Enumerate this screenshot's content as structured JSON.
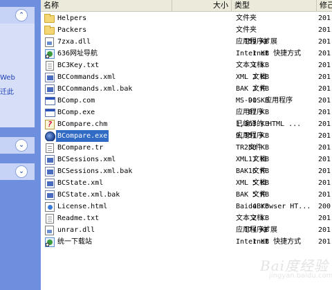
{
  "left_panel": {
    "links": [
      "Web",
      "迁此"
    ]
  },
  "header": {
    "name": "名称",
    "size": "大小",
    "type": "类型",
    "date": "修己"
  },
  "files": [
    {
      "name": "Helpers",
      "size": "",
      "type": "文件夹",
      "date": "201",
      "icon": "folder-icon"
    },
    {
      "name": "Packers",
      "size": "",
      "type": "文件夹",
      "date": "201",
      "icon": "folder-icon"
    },
    {
      "name": "7zxa.dll",
      "size": "159 KB",
      "type": "应用程序扩展",
      "date": "201",
      "icon": "dll-icon"
    },
    {
      "name": "636网址导航",
      "size": "1 KB",
      "type": "Internet 快捷方式",
      "date": "201",
      "icon": "link-icon"
    },
    {
      "name": "BC3Key.txt",
      "size": "1 KB",
      "type": "文本文档",
      "date": "201",
      "icon": "text-icon"
    },
    {
      "name": "BCCommands.xml",
      "size": "2 KB",
      "type": "XML 文档",
      "date": "201",
      "icon": "xml-icon"
    },
    {
      "name": "BCCommands.xml.bak",
      "size": "2 KB",
      "type": "BAK 文件",
      "date": "201",
      "icon": "xml-icon"
    },
    {
      "name": "BComp.com",
      "size": "91 KB",
      "type": "MS-DOS 应用程序",
      "date": "201",
      "icon": "window-icon"
    },
    {
      "name": "BComp.exe",
      "size": "87 KB",
      "type": "应用程序",
      "date": "201",
      "icon": "window-icon"
    },
    {
      "name": "BCompare.chm",
      "size": "1,363 KB",
      "type": "已编译的 HTML ...",
      "date": "201",
      "icon": "chm-icon"
    },
    {
      "name": "BCompare.exe",
      "size": "9,351 KB",
      "type": "应用程序",
      "date": "201",
      "icon": "exe-icon",
      "selected": true
    },
    {
      "name": "BCompare.tr",
      "size": "288 KB",
      "type": "TR 文件",
      "date": "201",
      "icon": "text-icon"
    },
    {
      "name": "BCSessions.xml",
      "size": "17 KB",
      "type": "XML 文档",
      "date": "201",
      "icon": "xml-icon"
    },
    {
      "name": "BCSessions.xml.bak",
      "size": "16 KB",
      "type": "BAK 文件",
      "date": "201",
      "icon": "xml-icon"
    },
    {
      "name": "BCState.xml",
      "size": "5 KB",
      "type": "XML 文档",
      "date": "201",
      "icon": "xml-icon"
    },
    {
      "name": "BCState.xml.bak",
      "size": "5 KB",
      "type": "BAK 文件",
      "date": "201",
      "icon": "xml-icon"
    },
    {
      "name": "License.html",
      "size": "4 KB",
      "type": "BaiduBrowser HT...",
      "date": "200",
      "icon": "html-icon"
    },
    {
      "name": "Readme.txt",
      "size": "2 KB",
      "type": "文本文档",
      "date": "201",
      "icon": "text-icon"
    },
    {
      "name": "unrar.dll",
      "size": "174 KB",
      "type": "应用程序扩展",
      "date": "201",
      "icon": "dll-icon"
    },
    {
      "name": "统一下载站",
      "size": "1 KB",
      "type": "Internet 快捷方式",
      "date": "201",
      "icon": "link-icon"
    }
  ],
  "watermark": {
    "main": "Bai度经验",
    "sub": "jingyan.baidu.com"
  }
}
